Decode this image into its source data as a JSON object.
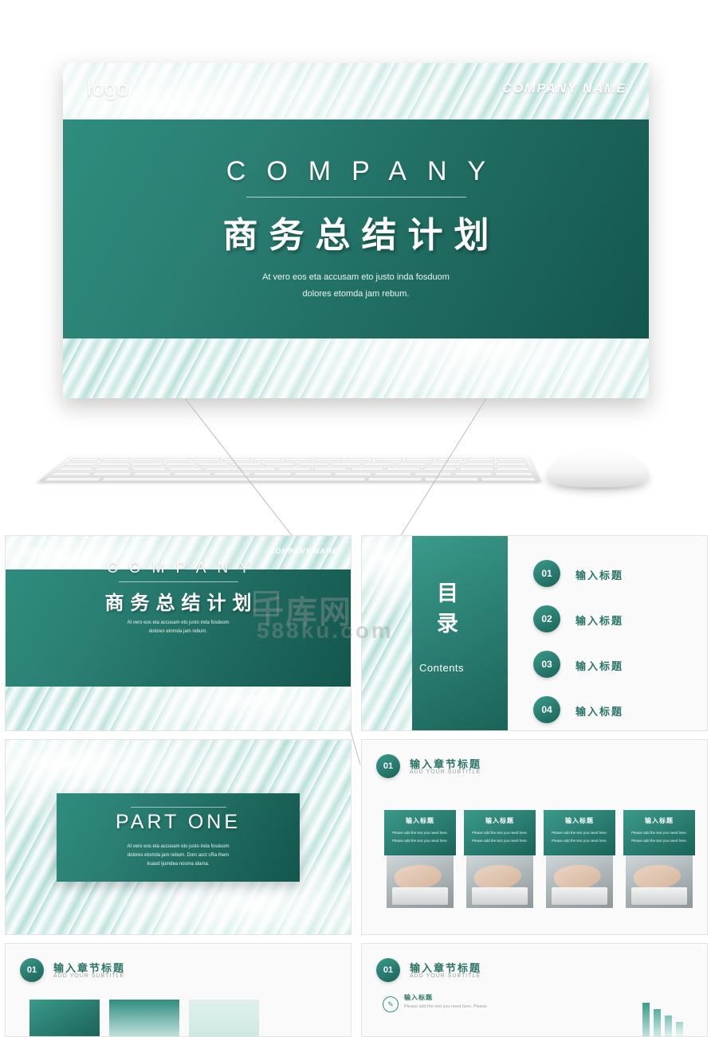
{
  "hero": {
    "logo": "logo",
    "company_name": "COMPANY NAME",
    "title_en": "COMPANY",
    "title_cn": "商务总结计划",
    "subtitle_line1": "At vero eos eta accusam eto justo inda fosduom",
    "subtitle_line2": "dolores etomda jam rebum."
  },
  "watermark": {
    "main": "千库网",
    "sub": "588ku.com"
  },
  "slides": {
    "cover": {
      "logo": "logo",
      "company_name": "COMPANY NAME",
      "title_en": "COMPANY",
      "title_cn": "商务总结计划",
      "subtitle_line1": "At vero eos eta accusam eto justo inda fosduom",
      "subtitle_line2": "dolores etomda jam rebum."
    },
    "contents": {
      "cn_line1": "目",
      "cn_line2": "录",
      "label_en": "Contents",
      "items": [
        {
          "num": "01",
          "label": "输入标题"
        },
        {
          "num": "02",
          "label": "输入标题"
        },
        {
          "num": "03",
          "label": "输入标题"
        },
        {
          "num": "04",
          "label": "输入标题"
        }
      ]
    },
    "part_one": {
      "title": "PART ONE",
      "sub_line1": "At vero eos eta accusam eto justo inda fosduom",
      "sub_line2": "dolores etomda jam rebum.  Dom asct cRa them",
      "sub_line3": "kuasd ljumdea nosma idama."
    },
    "section_columns": {
      "badge": "01",
      "title": "输入章节标题",
      "subtitle": "ADD YOUR SUBTITLE",
      "columns": [
        {
          "title": "输入标题",
          "line1": "Please add the text you need here.",
          "line2": "Please add the text you need here."
        },
        {
          "title": "输入标题",
          "line1": "Please add the text you need here.",
          "line2": "Please add the text you need here."
        },
        {
          "title": "输入标题",
          "line1": "Please add the text you need here.",
          "line2": "Please add the text you need here."
        },
        {
          "title": "输入标题",
          "line1": "Please add the text you need here.",
          "line2": "Please add the text you need here."
        }
      ]
    },
    "section_bars": {
      "badge": "01",
      "title": "输入章节标题",
      "subtitle": "ADD YOUR SUBTITLE"
    },
    "section_list": {
      "badge": "01",
      "title": "输入章节标题",
      "subtitle": "ADD YOUR SUBTITLE",
      "item_title": "输入标题",
      "item_text": "Please add the text you need here.   Please"
    }
  },
  "colors": {
    "teal_dark": "#14564d",
    "teal_mid": "#2a7e72",
    "teal_light": "#3a9b8b",
    "marble_light": "#e8f6f4",
    "card_bg": "#fafafa",
    "text_teal": "#2a7468"
  }
}
